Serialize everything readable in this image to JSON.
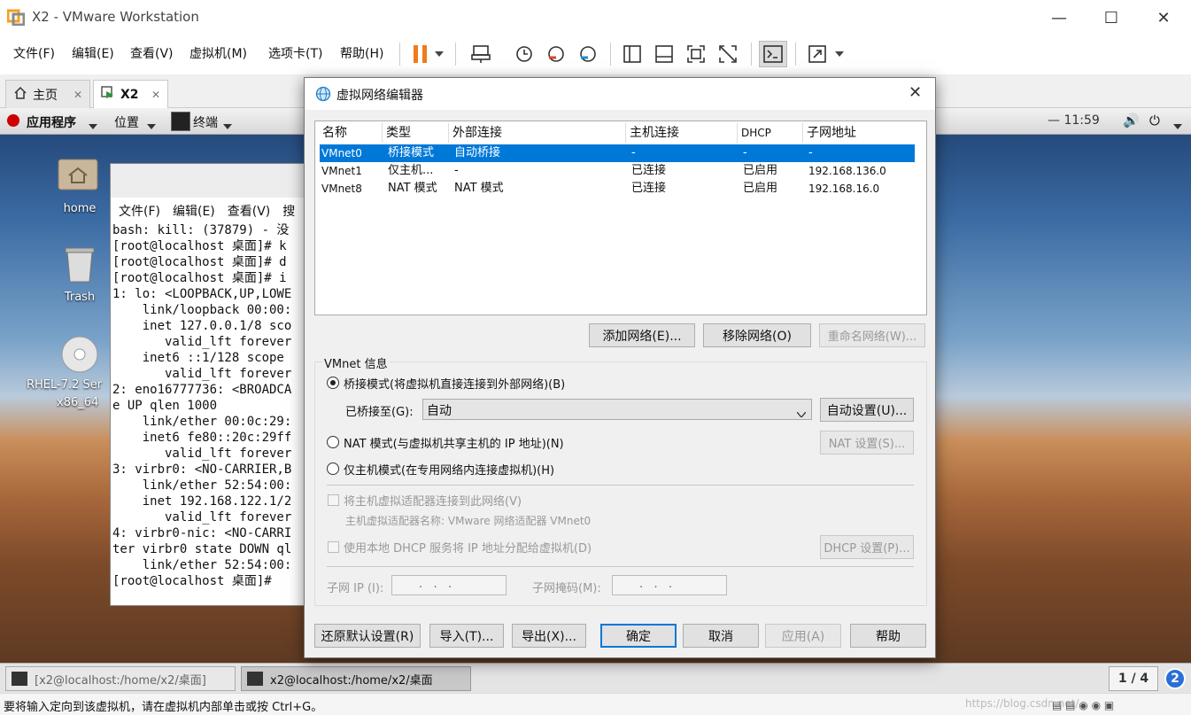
{
  "window": {
    "title": "X2 - VMware Workstation"
  },
  "menu": [
    "文件(F)",
    "编辑(E)",
    "查看(V)",
    "虚拟机(M)",
    "选项卡(T)",
    "帮助(H)"
  ],
  "tabs": [
    {
      "label": "主页"
    },
    {
      "label": "X2"
    }
  ],
  "guest": {
    "top_menu": [
      "应用程序",
      "位置",
      "终端"
    ],
    "clock": "11:59",
    "desktop_icons": [
      "home",
      "Trash",
      "RHEL-7.2 Ser",
      "x86_64"
    ],
    "terminal_menu": [
      "文件(F)",
      "编辑(E)",
      "查看(V)",
      "搜"
    ],
    "terminal_lines": [
      "bash: kill: (37879) - 没",
      "[root@localhost 桌面]# k",
      "[root@localhost 桌面]# d",
      "[root@localhost 桌面]# i",
      "1: lo: <LOOPBACK,UP,LOWE",
      "    link/loopback 00:00:",
      "    inet 127.0.0.1/8 sco",
      "       valid_lft forever",
      "    inet6 ::1/128 scope",
      "       valid_lft forever",
      "2: eno16777736: <BROADCA",
      "e UP qlen 1000",
      "    link/ether 00:0c:29:",
      "    inet6 fe80::20c:29ff",
      "       valid_lft forever",
      "3: virbr0: <NO-CARRIER,B",
      "",
      "    link/ether 52:54:00:",
      "    inet 192.168.122.1/2",
      "       valid_lft forever",
      "4: virbr0-nic: <NO-CARRI",
      "ter virbr0 state DOWN ql",
      "    link/ether 52:54:00:",
      "[root@localhost 桌面]# "
    ],
    "taskbar": [
      "[x2@localhost:/home/x2/桌面]",
      "x2@localhost:/home/x2/桌面"
    ],
    "workspace": "1 / 4",
    "notifications": "2"
  },
  "status": {
    "hint": "要将输入定向到该虚拟机，请在虚拟机内部单击或按 Ctrl+G。",
    "watermark": "https://blog.csdn.net/..."
  },
  "dialog": {
    "title": "虚拟网络编辑器",
    "columns": [
      "名称",
      "类型",
      "外部连接",
      "主机连接",
      "DHCP",
      "子网地址"
    ],
    "rows": [
      {
        "name": "VMnet0",
        "type": "桥接模式",
        "ext": "自动桥接",
        "host": "-",
        "dhcp": "-",
        "subnet": "-"
      },
      {
        "name": "VMnet1",
        "type": "仅主机...",
        "ext": "-",
        "host": "已连接",
        "dhcp": "已启用",
        "subnet": "192.168.136.0"
      },
      {
        "name": "VMnet8",
        "type": "NAT 模式",
        "ext": "NAT 模式",
        "host": "已连接",
        "dhcp": "已启用",
        "subnet": "192.168.16.0"
      }
    ],
    "add_network": "添加网络(E)...",
    "remove_network": "移除网络(O)",
    "rename_network": "重命名网络(W)...",
    "info_group": "VMnet 信息",
    "bridge_radio": "桥接模式(将虚拟机直接连接到外部网络)(B)",
    "bridge_to_label": "已桥接至(G):",
    "bridge_to_value": "自动",
    "auto_settings": "自动设置(U)...",
    "nat_radio": "NAT 模式(与虚拟机共享主机的 IP 地址)(N)",
    "nat_settings": "NAT 设置(S)...",
    "host_only_radio": "仅主机模式(在专用网络内连接虚拟机)(H)",
    "connect_adapter": "将主机虚拟适配器连接到此网络(V)",
    "adapter_name": "主机虚拟适配器名称: VMware 网络适配器 VMnet0",
    "use_dhcp": "使用本地 DHCP 服务将 IP 地址分配给虚拟机(D)",
    "dhcp_settings": "DHCP 设置(P)...",
    "subnet_ip_label": "子网 IP (I):",
    "subnet_ip_value": ".   .   .",
    "subnet_mask_label": "子网掩码(M):",
    "subnet_mask_value": ".   .   .",
    "restore_defaults": "还原默认设置(R)",
    "import": "导入(T)...",
    "export": "导出(X)...",
    "ok": "确定",
    "cancel": "取消",
    "apply": "应用(A)",
    "help": "帮助"
  },
  "colors": {
    "accent": "#0078d7",
    "selection": "#0078d7",
    "pause_orange": "#f07b1d"
  }
}
